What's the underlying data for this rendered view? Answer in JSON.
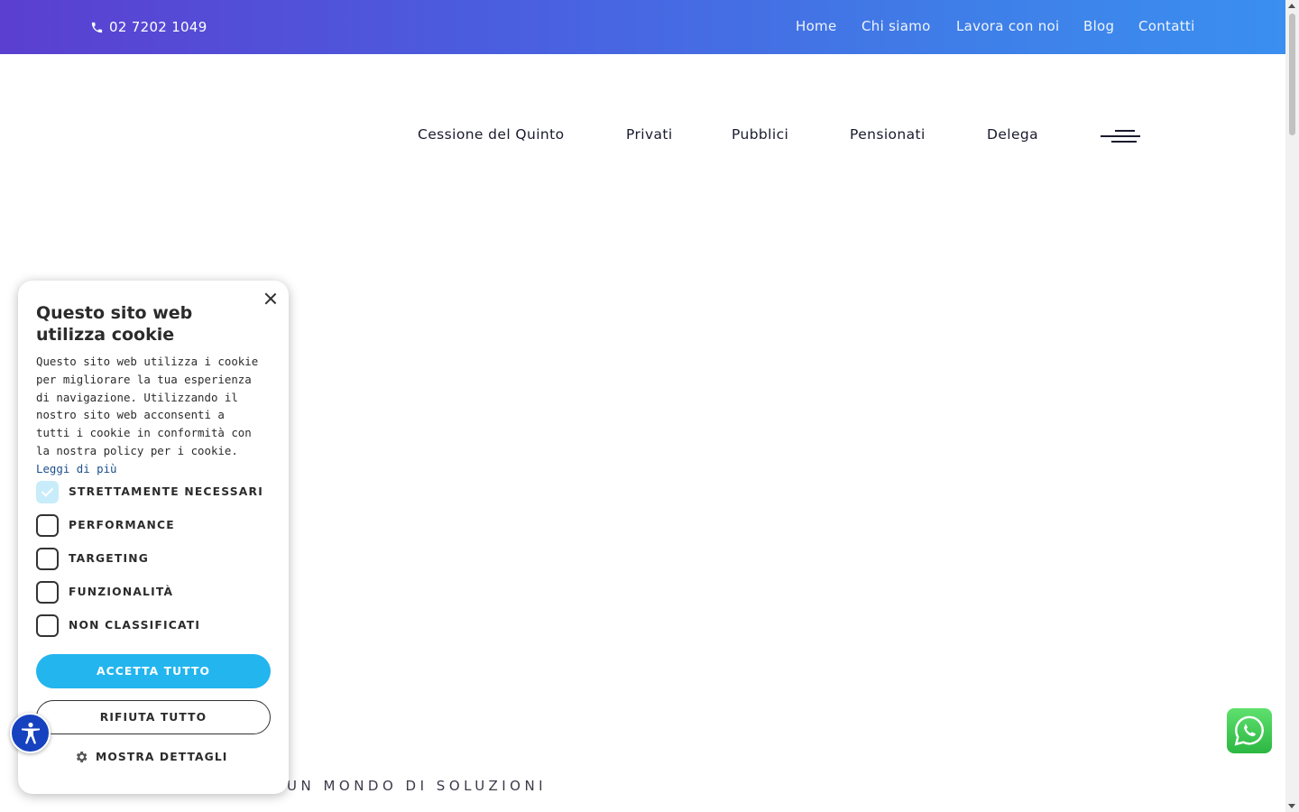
{
  "topbar": {
    "phone": "02 7202 1049",
    "nav": [
      "Home",
      "Chi siamo",
      "Lavora con noi",
      "Blog",
      "Contatti"
    ]
  },
  "mainnav": {
    "items": [
      "Cessione del Quinto",
      "Privati",
      "Pubblici",
      "Pensionati",
      "Delega"
    ]
  },
  "tagline": "UN MONDO DI SOLUZIONI",
  "cookie": {
    "title": "Questo sito web utilizza cookie",
    "text": "Questo sito web utilizza i cookie per migliorare la tua esperienza di navigazione. Utilizzando il nostro sito web acconsenti a tutti i cookie in conformità con la nostra policy per i cookie.",
    "link": "Leggi di più",
    "options": [
      {
        "label": "STRETTAMENTE NECESSARI",
        "checked": true
      },
      {
        "label": "PERFORMANCE",
        "checked": false
      },
      {
        "label": "TARGETING",
        "checked": false
      },
      {
        "label": "FUNZIONALITÀ",
        "checked": false
      },
      {
        "label": "NON CLASSIFICATI",
        "checked": false
      }
    ],
    "accept": "ACCETTA TUTTO",
    "reject": "RIFIUTA TUTTO",
    "details": "MOSTRA DETTAGLI"
  },
  "colors": {
    "topbar_start": "#5b3fd0",
    "topbar_end": "#3a8ff0",
    "accept_button": "#23b5ee",
    "accessibility": "#1642c0",
    "whatsapp": "#2cb742"
  },
  "icons": [
    "phone-icon",
    "hamburger-menu-icon",
    "close-icon",
    "gear-icon",
    "accessibility-icon",
    "whatsapp-icon"
  ]
}
